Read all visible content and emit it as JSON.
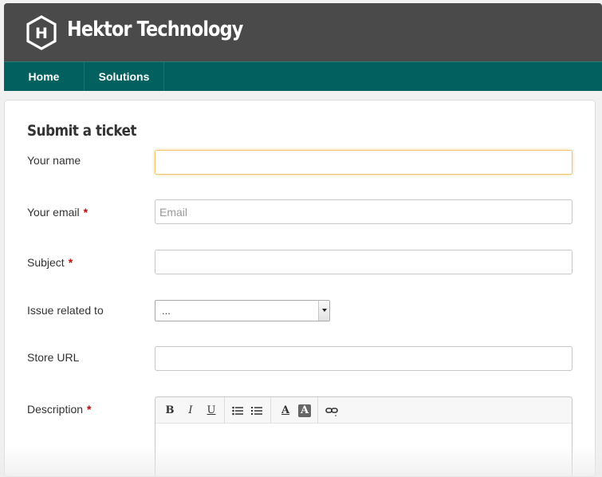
{
  "header": {
    "brand": "Hektor Technology",
    "logo_letter": "H"
  },
  "nav": {
    "items": [
      {
        "label": "Home"
      },
      {
        "label": "Solutions"
      }
    ]
  },
  "form": {
    "title": "Submit a ticket",
    "required_marker": "*",
    "fields": {
      "name": {
        "label": "Your name",
        "value": "",
        "placeholder": ""
      },
      "email": {
        "label": "Your email",
        "value": "",
        "placeholder": "Email"
      },
      "subject": {
        "label": "Subject",
        "value": "",
        "placeholder": ""
      },
      "issue": {
        "label": "Issue related to",
        "selected": "..."
      },
      "store_url": {
        "label": "Store URL",
        "value": "",
        "placeholder": ""
      },
      "description": {
        "label": "Description"
      }
    },
    "toolbar": {
      "bold": "B",
      "italic": "I",
      "underline": "U",
      "font_color": "A",
      "bg_color": "A"
    }
  },
  "colors": {
    "header_bg": "#4a4a4a",
    "nav_bg": "#02605e",
    "required": "#cc0000",
    "focus_border": "#f0c46a"
  }
}
